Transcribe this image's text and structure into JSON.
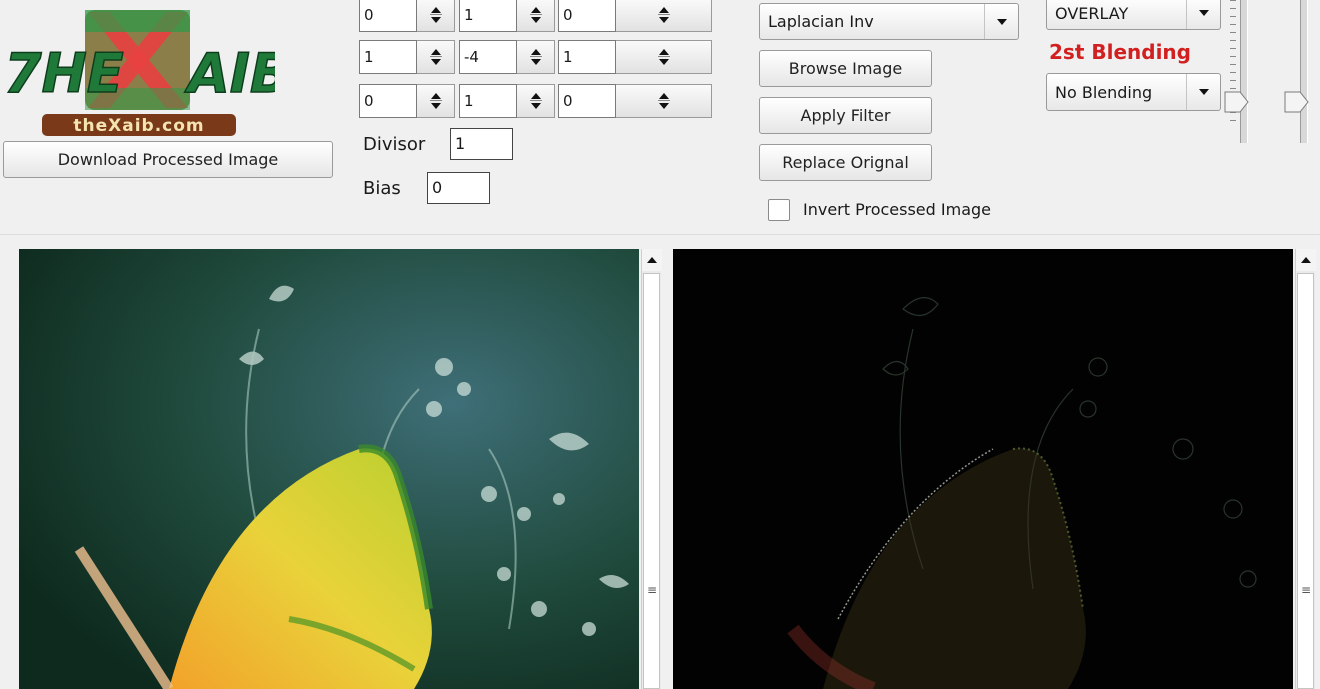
{
  "logo": {
    "text_left": "THE",
    "text_right": "AIB",
    "url_text": "theXaib.com"
  },
  "download_button": "Download Processed Image",
  "kernel": [
    [
      "0",
      "1",
      "0"
    ],
    [
      "1",
      "-4",
      "1"
    ],
    [
      "0",
      "1",
      "0"
    ]
  ],
  "divisor": {
    "label": "Divisor",
    "value": "1"
  },
  "bias": {
    "label": "Bias",
    "value": "0"
  },
  "filter_select": {
    "value": "Laplacian Inv"
  },
  "browse_button": "Browse Image",
  "apply_button": "Apply Filter",
  "replace_button": "Replace Orignal",
  "invert_checkbox": {
    "label": "Invert Processed Image",
    "checked": false
  },
  "blend1_select": {
    "value": "OVERLAY"
  },
  "blend2_label": "2st Blending",
  "blend2_select": {
    "value": "No Blending"
  },
  "colors": {
    "accent_red": "#d21f1f",
    "logo_green": "#1f7a3a",
    "logo_red": "#e02828"
  }
}
